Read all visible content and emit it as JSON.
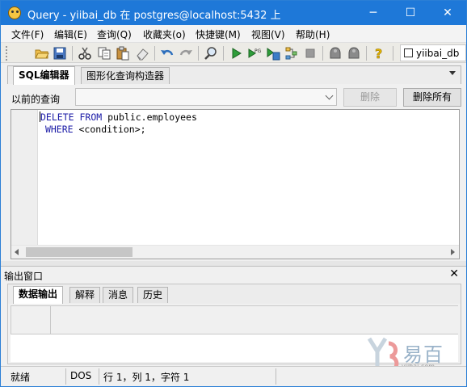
{
  "window": {
    "title": "Query - yiibai_db 在  postgres@localhost:5432 上",
    "app_icon": "pgadmin-elephant-icon"
  },
  "window_controls": {
    "minimize": "─",
    "maximize": "☐",
    "close": "✕"
  },
  "menu": {
    "items": [
      "文件(F)",
      "编辑(E)",
      "查询(Q)",
      "收藏夹(o)",
      "快捷键(M)",
      "视图(V)",
      "帮助(H)"
    ]
  },
  "toolbar": {
    "icons": [
      "open-folder-icon",
      "save-icon",
      "cut-icon",
      "copy-icon",
      "paste-icon",
      "eraser-icon",
      "undo-icon",
      "redo-icon",
      "find-icon",
      "execute-icon",
      "execute-pgscript-icon",
      "execute-to-file-icon",
      "explain-icon",
      "stop-icon",
      "sql-icon",
      "sql-analyze-icon",
      "help-icon"
    ],
    "database_label": "yiibai_db"
  },
  "editor_tabs": [
    "SQL编辑器",
    "图形化查询构造器"
  ],
  "history": {
    "label": "以前的查询",
    "selected": "",
    "delete_label": "删除",
    "delete_all_label": "删除所有"
  },
  "editor": {
    "line1": {
      "keyword1": "DELETE",
      "keyword2": "FROM",
      "rest": "public.employees"
    },
    "line2": {
      "keyword": "WHERE",
      "rest": "<condition>;"
    }
  },
  "output": {
    "title": "输出窗口",
    "close": "✕",
    "tabs": [
      "数据输出",
      "解释",
      "消息",
      "历史"
    ]
  },
  "watermark": {
    "text": "易百",
    "url": "yiibai.com"
  },
  "status": {
    "state": "就绪",
    "encoding": "DOS",
    "position": "行 1，列 1，字符 1"
  },
  "colors": {
    "titlebar": "#1e78d8",
    "keyword": "#1a1aa6"
  }
}
